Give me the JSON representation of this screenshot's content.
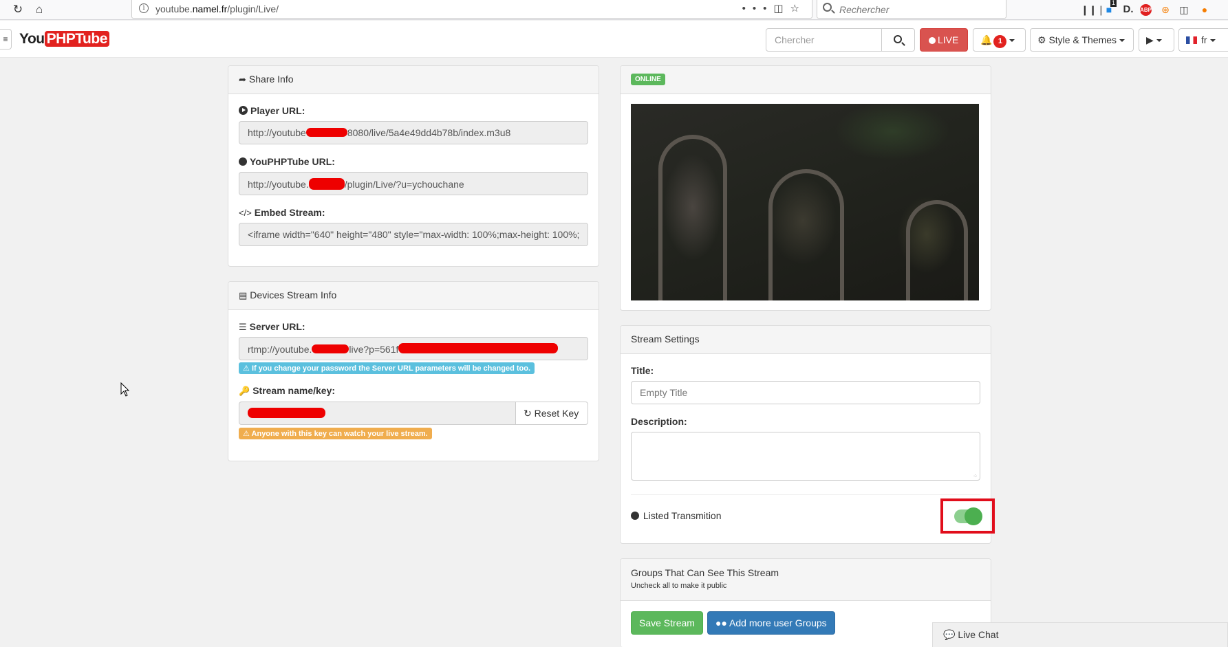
{
  "browser": {
    "url_prefix": "youtube.",
    "url_domain": "namel.fr",
    "url_path": "/plugin/Live/",
    "search_placeholder": "Rechercher",
    "notif_badge": "1",
    "abp_label": "ABP"
  },
  "navbar": {
    "logo_you": "You",
    "logo_tube": "PHPTube",
    "search_placeholder": "Chercher",
    "live_label": "LIVE",
    "notifications_count": "1",
    "style_label": "Style & Themes",
    "lang_label": "fr"
  },
  "share": {
    "heading": "Share Info",
    "player_label": "Player URL:",
    "player_prefix": "http://youtube",
    "player_suffix": "8080/live/5a4e49dd4b78b/index.m3u8",
    "youphptube_label": "YouPHPTube URL:",
    "youphptube_prefix": "http://youtube.",
    "youphptube_suffix": "/plugin/Live/?u=ychouchane",
    "embed_label": "Embed Stream:",
    "embed_value": "<iframe width=\"640\" height=\"480\" style=\"max-width: 100%;max-height: 100%;"
  },
  "devices": {
    "heading": "Devices Stream Info",
    "server_label": "Server URL:",
    "server_prefix": "rtmp://youtube.",
    "server_middle": "live?p=561f",
    "server_warning": "If you change your password the Server URL parameters will be changed too.",
    "key_label": "Stream name/key:",
    "reset_label": "Reset Key",
    "key_warning": "Anyone with this key can watch your live stream."
  },
  "status": {
    "label": "ONLINE"
  },
  "settings": {
    "heading": "Stream Settings",
    "title_label": "Title:",
    "title_placeholder": "Empty Title",
    "description_label": "Description:",
    "listed_label": "Listed Transmition",
    "listed_on": true
  },
  "groups": {
    "heading": "Groups That Can See This Stream",
    "subheading": "Uncheck all to make it public",
    "save_label": "Save Stream",
    "add_label": "Add more user Groups"
  },
  "chat": {
    "label": "Live Chat"
  },
  "colors": {
    "brand_red": "#e2221f",
    "success": "#5cb85c",
    "primary": "#337ab7",
    "info": "#5bc0de",
    "warning": "#f0ad4e",
    "highlight": "#e10d1b"
  }
}
